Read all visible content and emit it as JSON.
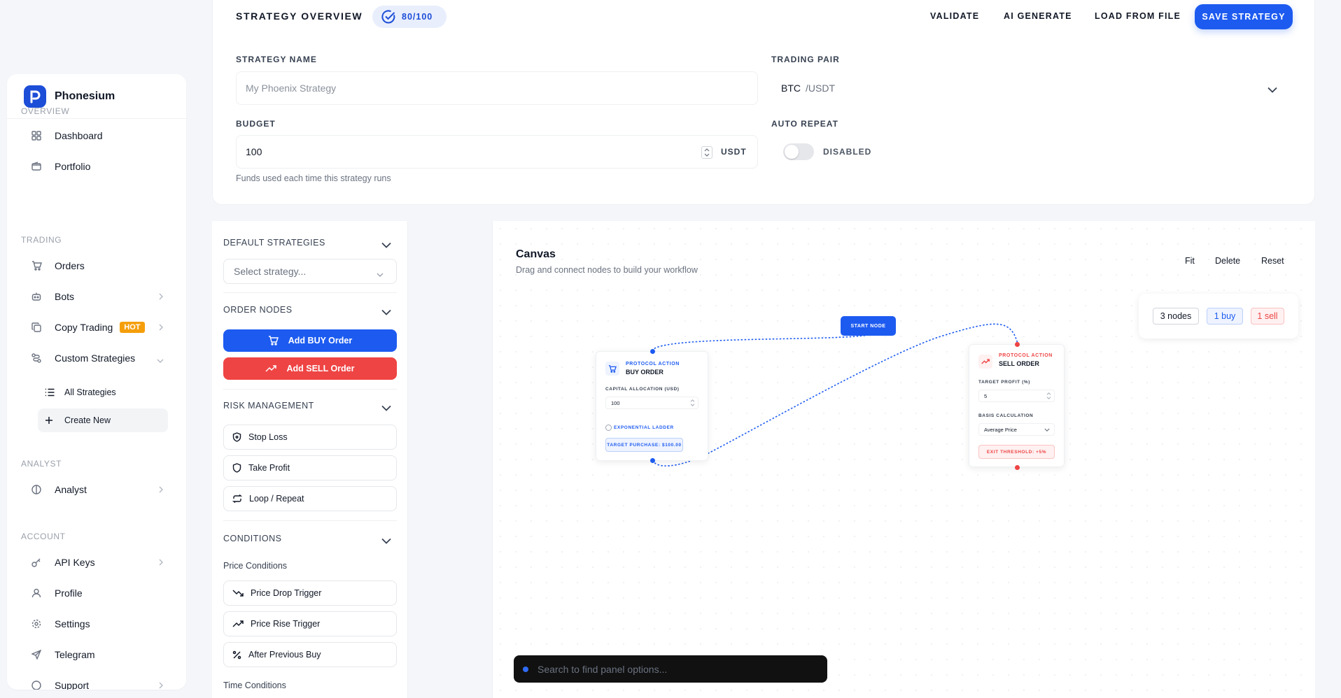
{
  "brand": {
    "name": "Phonesium"
  },
  "sidebar": {
    "sections": {
      "overview": "OVERVIEW",
      "trading": "TRADING",
      "analyst": "ANALYST",
      "account": "ACCOUNT"
    },
    "items": {
      "dashboard": "Dashboard",
      "portfolio": "Portfolio",
      "orders": "Orders",
      "bots": "Bots",
      "copy_trading": "Copy Trading",
      "copy_trading_badge": "HOT",
      "custom_strategies": "Custom Strategies",
      "all_strategies": "All Strategies",
      "create_new": "Create New",
      "analyst": "Analyst",
      "api_keys": "API Keys",
      "profile": "Profile",
      "settings": "Settings",
      "telegram": "Telegram",
      "support": "Support"
    }
  },
  "header": {
    "title": "STRATEGY OVERVIEW",
    "score": "80/100",
    "validate": "VALIDATE",
    "ai_generate": "AI GENERATE",
    "load_from_file": "LOAD FROM FILE",
    "save": "SAVE STRATEGY"
  },
  "form": {
    "strategy_name_label": "STRATEGY NAME",
    "strategy_name_placeholder": "My Phoenix Strategy",
    "trading_pair_label": "TRADING PAIR",
    "pair_base": "BTC",
    "pair_quote": "/USDT",
    "budget_label": "BUDGET",
    "budget_value": "100",
    "budget_unit": "USDT",
    "budget_hint": "Funds used each time this strategy runs",
    "auto_repeat_label": "AUTO REPEAT",
    "auto_repeat_state": "DISABLED"
  },
  "panel": {
    "default_strategies": "DEFAULT STRATEGIES",
    "select_placeholder": "Select strategy...",
    "order_nodes": "ORDER NODES",
    "add_buy": "Add BUY Order",
    "add_sell": "Add SELL Order",
    "risk_management": "RISK MANAGEMENT",
    "stop_loss": "Stop Loss",
    "take_profit": "Take Profit",
    "loop_repeat": "Loop / Repeat",
    "conditions": "CONDITIONS",
    "price_conditions": "Price Conditions",
    "price_drop": "Price Drop Trigger",
    "price_rise": "Price Rise Trigger",
    "after_prev_buy": "After Previous Buy",
    "time_conditions": "Time Conditions"
  },
  "canvas": {
    "title": "Canvas",
    "subtitle": "Drag and connect nodes to build your workflow",
    "fit": "Fit",
    "delete": "Delete",
    "reset": "Reset",
    "stats": {
      "nodes": "3 nodes",
      "buy": "1 buy",
      "sell": "1 sell"
    },
    "start_node": "START NODE",
    "buy_node": {
      "kicker": "PROTOCOL ACTION",
      "title": "BUY ORDER",
      "capital_label": "CAPITAL ALLOCATION (USD)",
      "capital_value": "100",
      "ladder": "EXPONENTIAL LADDER",
      "target": "TARGET PURCHASE: $100.00"
    },
    "sell_node": {
      "kicker": "PROTOCOL ACTION",
      "title": "SELL ORDER",
      "profit_label": "TARGET PROFIT (%)",
      "profit_value": "5",
      "basis_label": "BASIS CALCULATION",
      "basis_value": "Average Price",
      "exit": "EXIT THRESHOLD: +5%"
    },
    "search_placeholder": "Search to find panel options..."
  },
  "colors": {
    "primary": "#1d5bf0",
    "danger": "#ef4444",
    "hot": "#f59e0b"
  }
}
